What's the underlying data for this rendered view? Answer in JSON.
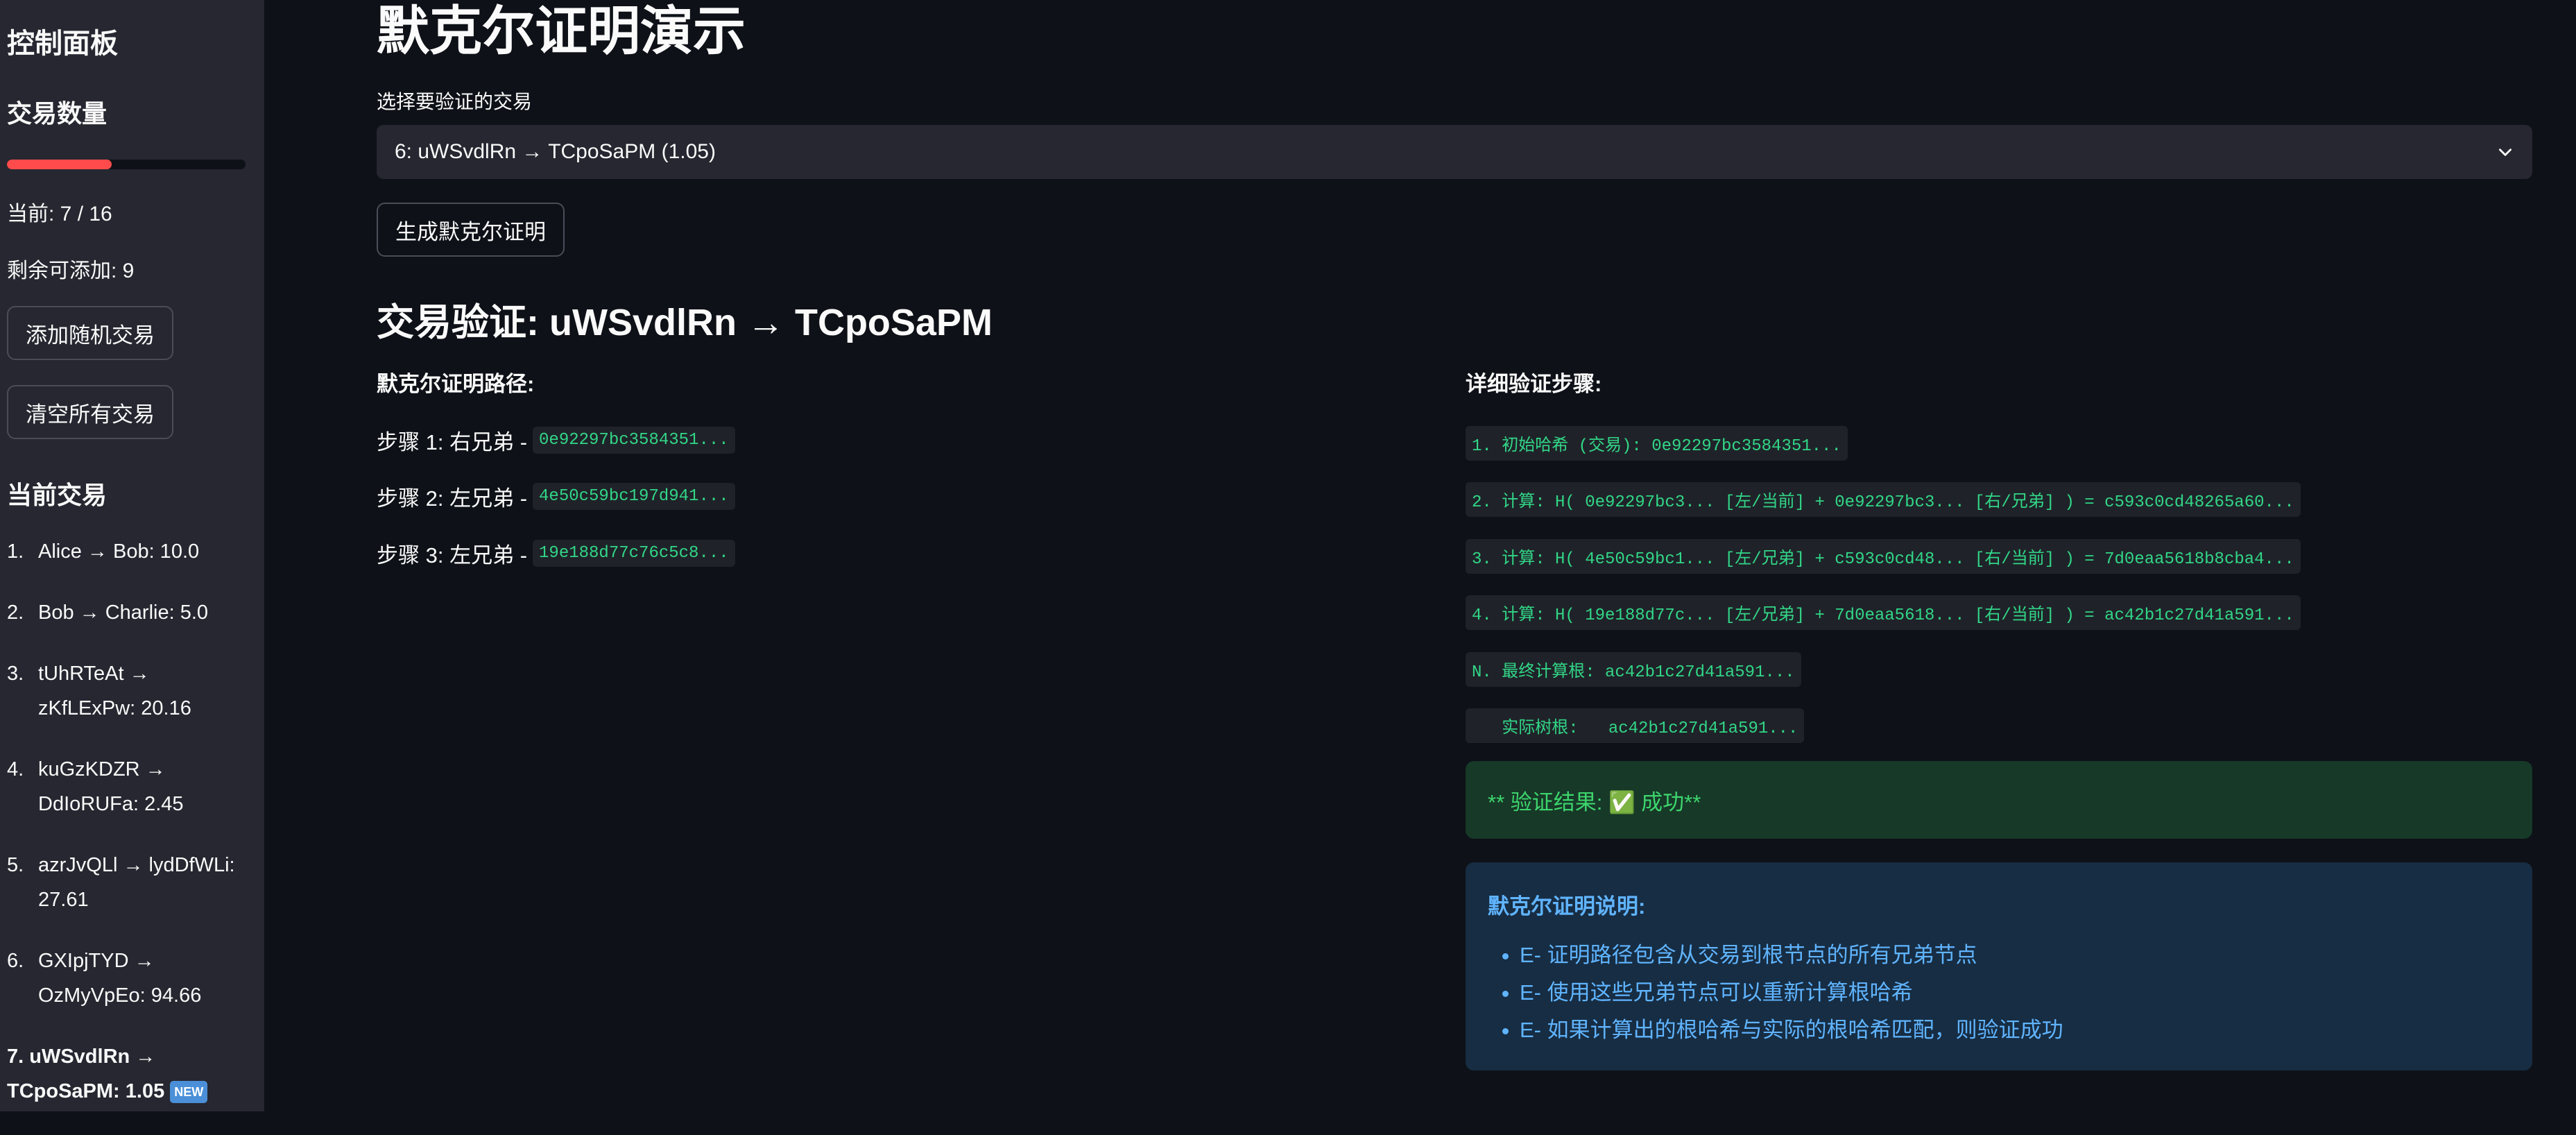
{
  "sidebar": {
    "title": "控制面板",
    "tx_count_title": "交易数量",
    "progress": {
      "current": 7,
      "max": 16,
      "color": "#ff4b4b"
    },
    "current_text": "当前: 7 / 16",
    "remaining_text": "剩余可添加: 9",
    "add_random_btn": "添加随机交易",
    "clear_all_btn": "清空所有交易",
    "current_tx_title": "当前交易",
    "transactions": [
      {
        "num": "1.",
        "text": "Alice → Bob: 10.0"
      },
      {
        "num": "2.",
        "text": "Bob → Charlie: 5.0"
      },
      {
        "num": "3.",
        "text": "tUhRTeAt → zKfLExPw: 20.16"
      },
      {
        "num": "4.",
        "text": "kuGzKDZR → DdIoRUFa: 2.45"
      },
      {
        "num": "5.",
        "text": "azrJvQLl → lydDfWLi: 27.61"
      },
      {
        "num": "6.",
        "text": "GXIpjTYD → OzMyVpEo: 94.66"
      }
    ],
    "current_tx": {
      "text": "7. uWSvdlRn → TCpoSaPM: 1.05",
      "badge": "NEW"
    }
  },
  "main": {
    "title": "默克尔证明演示",
    "select_label": "选择要验证的交易",
    "select_value": "6: uWSvdlRn → TCpoSaPM (1.05)",
    "chevron": "chevron-down-icon",
    "generate_btn": "生成默克尔证明",
    "verify_title": "交易验证: uWSvdlRn → TCpoSaPM",
    "proof_path_title": "默克尔证明路径:",
    "proof_steps": [
      {
        "label": "步骤 1: 右兄弟 -",
        "hash": "0e92297bc3584351..."
      },
      {
        "label": "步骤 2: 左兄弟 -",
        "hash": "4e50c59bc197d941..."
      },
      {
        "label": "步骤 3: 左兄弟 -",
        "hash": "19e188d77c76c5c8..."
      }
    ],
    "detail_title": "详细验证步骤:",
    "detail_steps": [
      "1. 初始哈希 (交易): 0e92297bc3584351...",
      "2. 计算: H( 0e92297bc3... [左/当前] + 0e92297bc3... [右/兄弟] ) = c593c0cd48265a60...",
      "3. 计算: H( 4e50c59bc1... [左/兄弟] + c593c0cd48... [右/当前] ) = 7d0eaa5618b8cba4...",
      "4. 计算: H( 19e188d77c... [左/兄弟] + 7d0eaa5618... [右/当前] ) = ac42b1c27d41a591...",
      "N. 最终计算根: ac42b1c27d41a591...",
      "   实际树根:   ac42b1c27d41a591..."
    ],
    "result_text": "** 验证结果: ✅ 成功**",
    "info_title": "默克尔证明说明:",
    "info_items": [
      "E- 证明路径包含从交易到根节点的所有兄弟节点",
      "E- 使用这些兄弟节点可以重新计算根哈希",
      "E- 如果计算出的根哈希与实际的根哈希匹配，则验证成功"
    ]
  }
}
